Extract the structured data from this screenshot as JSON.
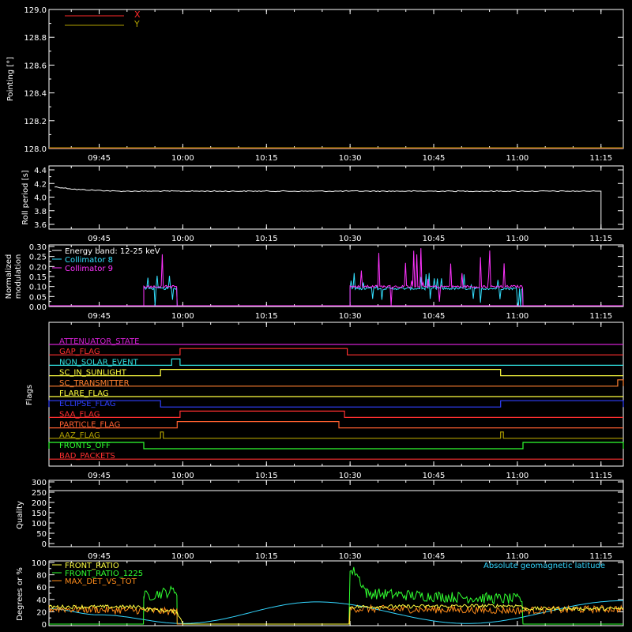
{
  "x_ticks": [
    "09:45",
    "10:00",
    "10:15",
    "10:30",
    "10:45",
    "11:00",
    "11:15"
  ],
  "panels": {
    "pointing": {
      "ylabel": "Pointing [°]",
      "yticks": [
        "129.0",
        "128.8",
        "128.6",
        "128.4",
        "128.2",
        "128.0"
      ],
      "legend": [
        {
          "name": "X",
          "color": "#ff2a2a"
        },
        {
          "name": "Y",
          "color": "#b0a000"
        }
      ]
    },
    "roll": {
      "ylabel": "Roll period [s]",
      "yticks": [
        "4.4",
        "4.2",
        "4.0",
        "3.8",
        "3.6"
      ]
    },
    "modulation": {
      "ylabel_line1": "Normalized",
      "ylabel_line2": "modulation",
      "yticks": [
        "0.30",
        "0.25",
        "0.20",
        "0.15",
        "0.10",
        "0.05",
        "0.00"
      ],
      "legend": [
        {
          "name": "Energy band: 12-25 keV",
          "color": "#ffffff"
        },
        {
          "name": "Collimator 8",
          "color": "#33e0ff"
        },
        {
          "name": "Collimator 9",
          "color": "#ff33ff"
        }
      ]
    },
    "flags": {
      "ylabel": "Flags",
      "items": [
        {
          "name": "ATTENUATOR_STATE",
          "color": "#d020d0"
        },
        {
          "name": "GAP_FLAG",
          "color": "#ff3030"
        },
        {
          "name": "NON_SOLAR_EVENT",
          "color": "#30e0e0"
        },
        {
          "name": "SC_IN_SUNLIGHT",
          "color": "#ffff40"
        },
        {
          "name": "SC_TRANSMITTER",
          "color": "#ff8030"
        },
        {
          "name": "FLARE_FLAG",
          "color": "#ffff40"
        },
        {
          "name": "ECLIPSE_FLAG",
          "color": "#3040ff"
        },
        {
          "name": "SAA_FLAG",
          "color": "#ff3030"
        },
        {
          "name": "PARTICLE_FLAG",
          "color": "#ff6030"
        },
        {
          "name": "AAZ_FLAG",
          "color": "#b0a000"
        },
        {
          "name": "FRONTS_OFF",
          "color": "#30ff30"
        },
        {
          "name": "BAD_PACKETS",
          "color": "#ff3030"
        }
      ]
    },
    "quality": {
      "ylabel": "Quality",
      "yticks": [
        "300",
        "250",
        "200",
        "150",
        "100",
        "50",
        "0"
      ]
    },
    "ratio": {
      "ylabel": "Degrees or %",
      "yticks": [
        "100",
        "80",
        "60",
        "40",
        "20",
        "0"
      ],
      "legend": [
        {
          "name": "FRONT_RATIO",
          "color": "#ffff40"
        },
        {
          "name": "FRONT_RATIO_1225",
          "color": "#30ff30"
        },
        {
          "name": "MAX_DET_VS_TOT",
          "color": "#ff8c1a"
        }
      ],
      "right_label": "Absolute geomagnetic latitude",
      "right_label_color": "#33d6ff"
    }
  },
  "chart_data": [
    {
      "type": "line",
      "panel": "pointing",
      "ylim": [
        128.0,
        129.0
      ],
      "series": [
        {
          "name": "X",
          "x": [
            "09:36",
            "11:19"
          ],
          "y": [
            128.0,
            128.0
          ]
        },
        {
          "name": "Y",
          "x": [
            "09:36",
            "11:19"
          ],
          "y": [
            128.0,
            128.0
          ]
        }
      ]
    },
    {
      "type": "line",
      "panel": "roll",
      "ylim": [
        3.5,
        4.5
      ],
      "series": [
        {
          "x": [
            "09:37",
            "09:41",
            "09:48",
            "10:00",
            "10:15",
            "10:30",
            "10:45",
            "11:00",
            "11:13",
            "11:14",
            "11:15"
          ],
          "y": [
            4.14,
            4.11,
            4.09,
            4.09,
            4.09,
            4.09,
            4.09,
            4.09,
            4.09,
            4.09,
            3.5
          ]
        }
      ]
    },
    {
      "type": "bar",
      "panel": "modulation",
      "ylim": [
        0.0,
        0.3
      ],
      "segments": [
        {
          "start": "09:53",
          "end": "09:59"
        },
        {
          "start": "10:30",
          "end": "11:01"
        }
      ],
      "series": [
        {
          "name": "Collimator 8",
          "typical": 0.09,
          "max": 0.17
        },
        {
          "name": "Collimator 9",
          "typical": 0.1,
          "max": 0.3
        }
      ]
    },
    {
      "type": "line",
      "panel": "flags",
      "series": [
        {
          "name": "ATTENUATOR_STATE",
          "changes": []
        },
        {
          "name": "GAP_FLAG",
          "changes": [
            [
              "09:59:30",
              "10:29:30"
            ]
          ]
        },
        {
          "name": "NON_SOLAR_EVENT",
          "changes": [
            [
              "09:58",
              "09:59:30"
            ]
          ]
        },
        {
          "name": "SC_IN_SUNLIGHT",
          "changes": [
            [
              "09:56",
              "10:57"
            ]
          ]
        },
        {
          "name": "SC_TRANSMITTER",
          "changes": [
            [
              "11:18",
              "11:19"
            ]
          ]
        },
        {
          "name": "FLARE_FLAG",
          "changes": []
        },
        {
          "name": "ECLIPSE_FLAG",
          "changes": [
            [
              "09:36",
              "09:56"
            ],
            [
              "10:57",
              "11:19"
            ]
          ]
        },
        {
          "name": "SAA_FLAG",
          "changes": [
            [
              "09:59:30",
              "10:29"
            ]
          ]
        },
        {
          "name": "PARTICLE_FLAG",
          "changes": [
            [
              "09:59",
              "10:28"
            ]
          ]
        },
        {
          "name": "AAZ_FLAG",
          "changes": [
            [
              "09:56",
              "09:56:30"
            ],
            [
              "10:57",
              "10:57:30"
            ]
          ]
        },
        {
          "name": "FRONTS_OFF",
          "changes": [
            [
              "09:36",
              "09:53"
            ],
            [
              "11:01",
              "11:19"
            ]
          ]
        },
        {
          "name": "BAD_PACKETS",
          "changes": []
        }
      ]
    },
    {
      "type": "line",
      "panel": "quality",
      "ylim": [
        0,
        300
      ],
      "series": [
        {
          "x": [
            "09:36",
            "11:19"
          ],
          "y": [
            300,
            300
          ]
        }
      ]
    },
    {
      "type": "line",
      "panel": "ratio",
      "ylim": [
        0,
        100
      ],
      "series": [
        {
          "name": "FRONT_RATIO",
          "x": [
            "09:36",
            "09:53",
            "09:53",
            "09:59",
            "10:00",
            "10:30",
            "10:30",
            "11:01",
            "11:01",
            "11:19"
          ],
          "y": [
            28,
            28,
            25,
            20,
            0,
            0,
            28,
            30,
            25,
            25
          ]
        },
        {
          "name": "FRONT_RATIO_1225",
          "x": [
            "09:36",
            "09:53",
            "09:53",
            "09:59",
            "09:59",
            "10:30",
            "10:30",
            "10:31",
            "10:33",
            "10:45",
            "11:01",
            "11:01",
            "11:19"
          ],
          "y": [
            0,
            0,
            45,
            55,
            0,
            0,
            85,
            85,
            50,
            45,
            40,
            0,
            0
          ]
        },
        {
          "name": "MAX_DET_VS_TOT",
          "x": [
            "09:36",
            "09:53",
            "09:59",
            "09:59",
            "10:30",
            "10:30",
            "11:01",
            "11:19"
          ],
          "y": [
            25,
            22,
            20,
            0,
            0,
            25,
            22,
            25
          ]
        },
        {
          "name": "Absolute geomagnetic latitude",
          "x": [
            "09:36",
            "09:45",
            "10:00",
            "10:24",
            "10:51",
            "11:19"
          ],
          "y": [
            25,
            15,
            1,
            36,
            1,
            38
          ]
        }
      ]
    }
  ]
}
